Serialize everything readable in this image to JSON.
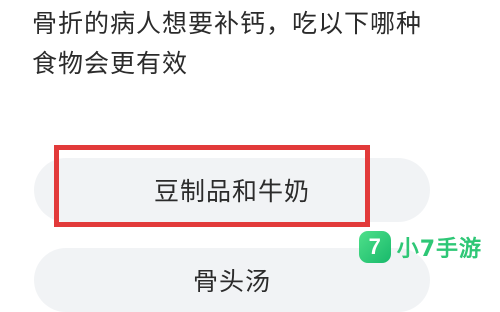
{
  "question": {
    "line1": "骨折的病人想要补钙，吃以下哪种",
    "line2": "食物会更有效"
  },
  "options": [
    {
      "label": "豆制品和牛奶",
      "highlighted": true
    },
    {
      "label": "骨头汤",
      "highlighted": false
    }
  ],
  "highlight_color": "#e23a3a",
  "watermark": {
    "logo_glyph": "7",
    "text": "小7手游",
    "color": "#2ec776"
  }
}
